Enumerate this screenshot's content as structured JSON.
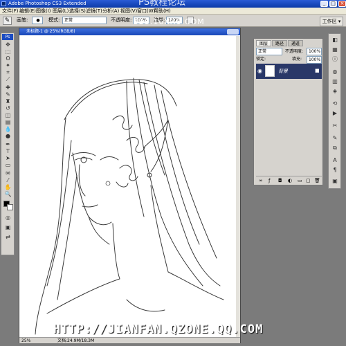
{
  "window": {
    "title": "Adobe Photoshop CS3 Extended",
    "watermark_title": "PS教程论坛"
  },
  "menu": [
    "文件(F)",
    "编辑(E)",
    "图像(I)",
    "图层(L)",
    "选择(S)",
    "滤镜(T)",
    "分析(A)",
    "视图(V)",
    "窗口(W)",
    "帮助(H)"
  ],
  "options": {
    "brush_label": "画笔:",
    "brush_size": "●",
    "mode_label": "模式:",
    "mode_value": "正常",
    "opacity_label": "不透明度:",
    "opacity_value": "100%",
    "flow_label": "流量:",
    "flow_value": "100%",
    "watermark": "BBS.16XX8.COM",
    "workspace": "工作区 ▾"
  },
  "toolbox": {
    "header": "Ps"
  },
  "document": {
    "title": "未标题-1 @ 25%(RGB/8)",
    "zoom": "25%",
    "doc_info": "文档:24.9M/18.3M"
  },
  "layers_panel": {
    "tabs": [
      "图层",
      "路径",
      "通道"
    ],
    "blend_mode": "正常",
    "opacity_label": "不透明度:",
    "opacity_value": "100%",
    "lock_label": "锁定:",
    "fill_label": "填充:",
    "fill_value": "100%",
    "layer_name": "背景",
    "selected_color": "#2a3868"
  },
  "footer_watermark": "HTTP://JIANFAN.QZONE.QQ.COM",
  "colors": {
    "titlebar": "#1c4cc2",
    "chrome": "#d6d3ce",
    "workspace": "#7b7b7b"
  }
}
